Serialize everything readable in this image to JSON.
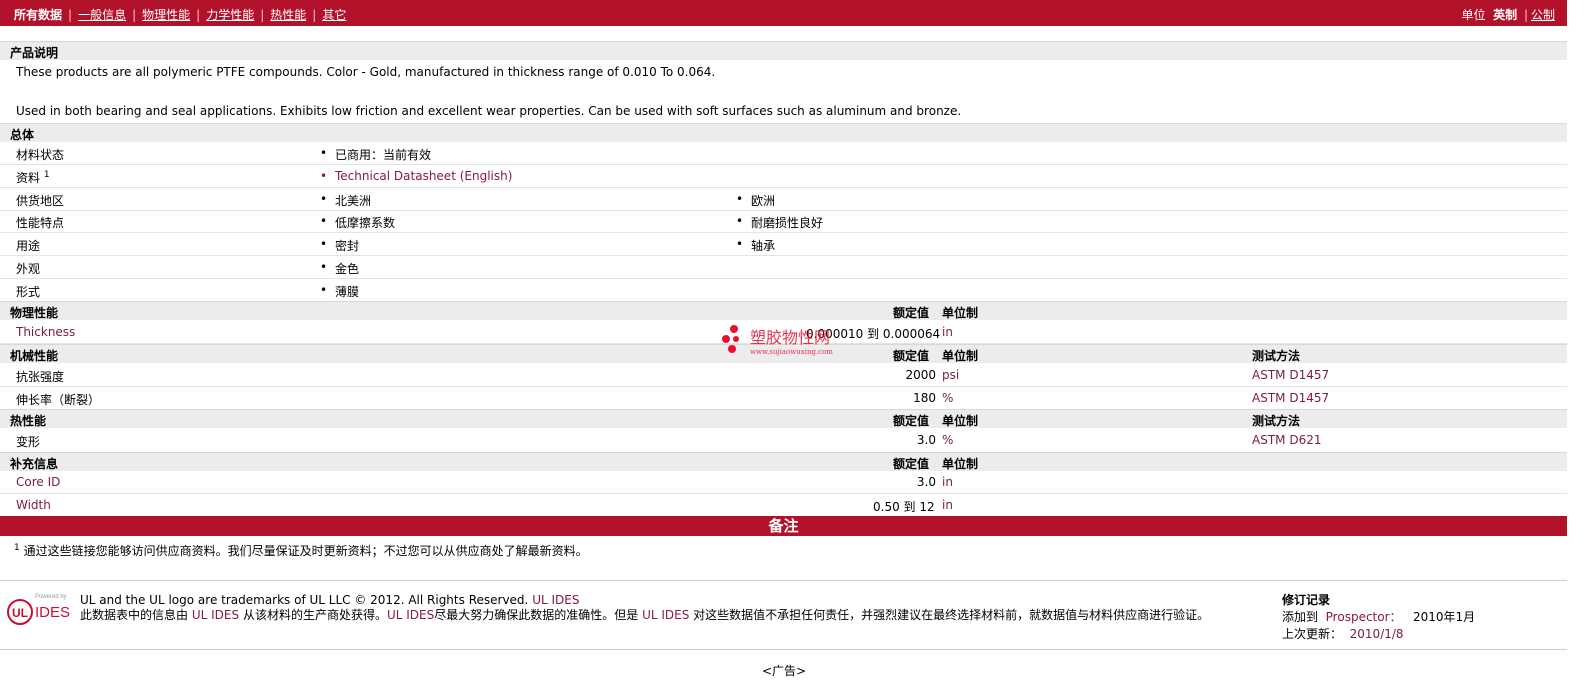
{
  "nav": {
    "items": [
      "所有数据",
      "一般信息",
      "物理性能",
      "力学性能",
      "热性能",
      "其它"
    ],
    "units_label": "单位",
    "unit_imperial": "英制",
    "unit_metric": "公制",
    "separator": "|"
  },
  "product": {
    "heading": "产品说明",
    "desc1": "These products are all polymeric PTFE compounds. Color - Gold, manufactured in thickness range of 0.010 To 0.064.",
    "desc2": "Used in both bearing and seal applications. Exhibits low friction and excellent wear properties. Can be used with soft surfaces such as aluminum and bronze."
  },
  "general": {
    "heading": "总体",
    "rows": [
      {
        "label": "材料状态",
        "values": [
          "已商用：当前有效"
        ]
      },
      {
        "label": "资料",
        "sup": "1",
        "values": [
          "Technical Datasheet (English)"
        ]
      },
      {
        "label": "供货地区",
        "values": [
          "北美洲",
          "欧洲"
        ]
      },
      {
        "label": "性能特点",
        "values": [
          "低摩擦系数",
          "耐磨损性良好"
        ]
      },
      {
        "label": "用途",
        "values": [
          "密封",
          "轴承"
        ]
      },
      {
        "label": "外观",
        "values": [
          "金色"
        ]
      },
      {
        "label": "形式",
        "values": [
          "薄膜"
        ]
      }
    ]
  },
  "headers": {
    "rated": "额定值",
    "unit": "单位制",
    "method": "测试方法"
  },
  "physical": {
    "heading": "物理性能",
    "rows": [
      {
        "label": "Thickness",
        "value": "0.000010 到  0.000064",
        "unit": "in"
      }
    ]
  },
  "mechanical": {
    "heading": "机械性能",
    "rows": [
      {
        "label": "抗张强度",
        "value": "2000",
        "unit": "psi",
        "method": "ASTM D1457"
      },
      {
        "label": "伸长率（断裂）",
        "value": "180",
        "unit": "%",
        "method": "ASTM D1457"
      }
    ]
  },
  "thermal": {
    "heading": "热性能",
    "rows": [
      {
        "label": "变形",
        "value": "3.0",
        "unit": "%",
        "method": "ASTM D621"
      }
    ]
  },
  "supplement": {
    "heading": "补充信息",
    "rows": [
      {
        "label": "Core ID",
        "value": "3.0",
        "unit": "in"
      },
      {
        "label": "Width",
        "value": "0.50 到  12",
        "unit": "in"
      }
    ]
  },
  "remarks": {
    "heading": "备注",
    "sup": "1",
    "note": "通过这些链接您能够访问供应商资料。我们尽量保证及时更新资料；不过您可以从供应商处了解最新资料。"
  },
  "footer": {
    "powered": "Powered by",
    "logo_text": "IDES",
    "ul_mark": "UL",
    "trademark": "UL and the UL logo are trademarks of UL LLC © 2012. All Rights Reserved.",
    "ul_ides": "UL IDES",
    "disclaimer_a": "此数据表中的信息由",
    "disclaimer_b": "从该材料的生产商处获得。",
    "disclaimer_c": "尽最大努力确保此数据的准确性。但是",
    "disclaimer_d": "对这些数据值不承担任何责任，并强烈建议在最终选择材料前，就数据值与材料供应商进行验",
    "disclaimer_e": "证。",
    "revision_heading": "修订记录",
    "added_label": "添加到",
    "added_site": "Prospector：",
    "added_date": "2010年1月",
    "updated_label": "上次更新：",
    "updated_date": "2010/1/8",
    "ad": "<广告>"
  },
  "watermark": {
    "text": "塑胶物性网",
    "url": "www.sujiaowuxing.com"
  },
  "colors": {
    "brand": "#b2112a",
    "link": "#8b1a3a"
  }
}
